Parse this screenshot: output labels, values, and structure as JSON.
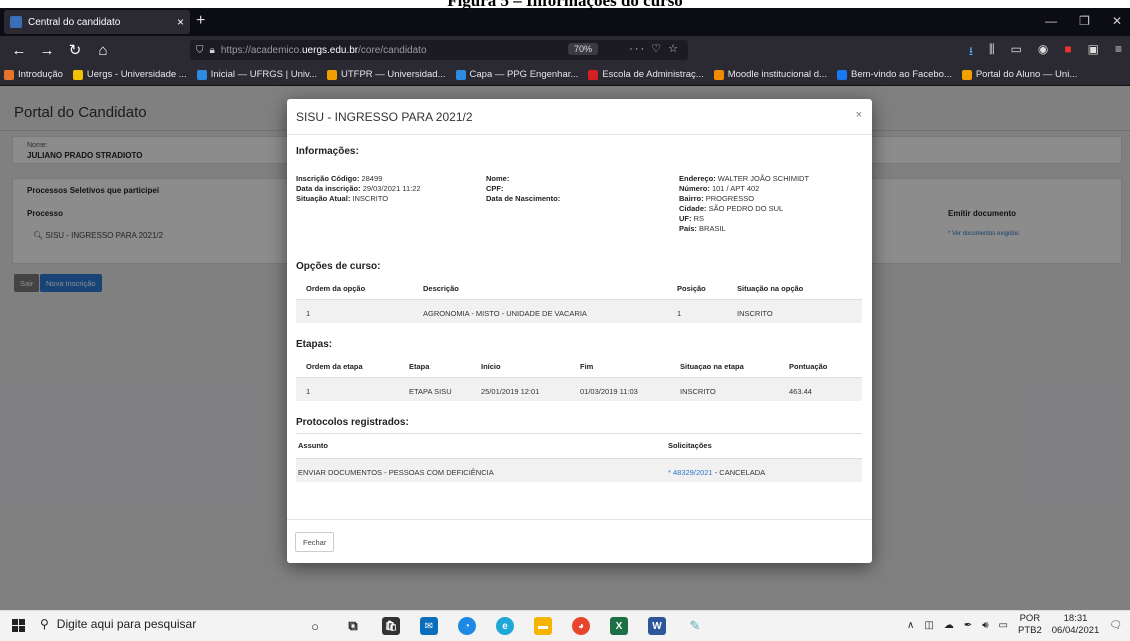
{
  "caption": "Figura 5 – Informações do curso",
  "browser": {
    "tab_title": "Central do candidato",
    "tab_close": "×",
    "new_tab": "+",
    "url_prefix": "https://academico.",
    "url_domain": "uergs.edu.br",
    "url_path": "/core/candidato",
    "zoom": "70%",
    "bookmarks": [
      {
        "label": "Introdução",
        "color": "#e8742c"
      },
      {
        "label": "Uergs - Universidade ...",
        "color": "#f2c200"
      },
      {
        "label": "Inicial — UFRGS | Univ...",
        "color": "#2c8be0"
      },
      {
        "label": "UTFPR — Universidad...",
        "color": "#f2a000"
      },
      {
        "label": "Capa — PPG Engenhar...",
        "color": "#2c8be0"
      },
      {
        "label": "Escola de Administraç...",
        "color": "#d42020"
      },
      {
        "label": "Moodle institucional d...",
        "color": "#f08a00"
      },
      {
        "label": "Bem-vindo ao Facebo...",
        "color": "#1877f2"
      },
      {
        "label": "Portal do Aluno — Uni...",
        "color": "#f2a000"
      }
    ]
  },
  "page": {
    "title": "Portal do Candidato",
    "name_label": "Nome:",
    "name_value": "JULIANO PRADO STRADIOTO",
    "processes_title": "Processos Seletivos que participei",
    "col_processo": "Processo",
    "col_emitir": "Emitir documento",
    "process_item": "SISU - INGRESSO PARA 2021/2",
    "doc_link": "* Ver documentos exigidos",
    "btn_sair": "Sair",
    "btn_nova": "Nova Inscrição"
  },
  "modal": {
    "title": "SISU - INGRESSO PARA 2021/2",
    "close_icon": "×",
    "informacoes": "Informações:",
    "inscricao_label": "Inscrição Código:",
    "inscricao_value": "28499",
    "data_label": "Data da inscrição:",
    "data_value": "29/03/2021 11:22",
    "situacao_label": "Situação Atual:",
    "situacao_value": "INSCRITO",
    "nome_label": "Nome:",
    "cpf_label": "CPF:",
    "nasc_label": "Data de Nascimento:",
    "endereco_label": "Endereço:",
    "endereco_value": "WALTER JOÃO SCHIMIDT",
    "numero_label": "Número:",
    "numero_value": "101 / APT 402",
    "bairro_label": "Bairro:",
    "bairro_value": "PROGRESSO",
    "cidade_label": "Cidade:",
    "cidade_value": "SÃO PEDRO DO SUL",
    "uf_label": "UF:",
    "uf_value": "RS",
    "pais_label": "País:",
    "pais_value": "BRASIL",
    "opcoes_title": "Opções de curso:",
    "opcoes_headers": [
      "Ordem da opção",
      "Descrição",
      "Posição",
      "Situação na opção"
    ],
    "opcoes_row": [
      "1",
      "AGRONOMIA - MISTO - UNIDADE DE VACARIA",
      "1",
      "INSCRITO"
    ],
    "etapas_title": "Etapas:",
    "etapas_headers": [
      "Ordem da etapa",
      "Etapa",
      "Início",
      "Fim",
      "Situaçao na etapa",
      "Pontuação"
    ],
    "etapas_row": [
      "1",
      "ETAPA SISU",
      "25/01/2019 12:01",
      "01/03/2019 11:03",
      "INSCRITO",
      "463.44"
    ],
    "protocolos_title": "Protocolos registrados:",
    "protocolos_headers": [
      "Assunto",
      "Solicitações"
    ],
    "protocolo_assunto": "ENVIAR DOCUMENTOS - PESSOAS COM DEFICIÊNCIA",
    "protocolo_link": "* 48329/2021",
    "protocolo_status": " - CANCELADA",
    "fechar": "Fechar"
  },
  "taskbar": {
    "search_placeholder": "Digite aqui para pesquisar",
    "lang1": "POR",
    "lang2": "PTB2",
    "time": "18:31",
    "date": "06/04/2021"
  }
}
